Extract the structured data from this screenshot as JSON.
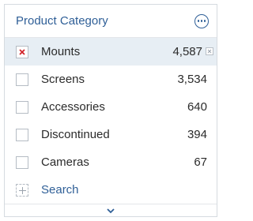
{
  "panel": {
    "title": "Product Category",
    "more_icon": "more-options-icon"
  },
  "items": [
    {
      "label": "Mounts",
      "count": "4,587",
      "selected": true
    },
    {
      "label": "Screens",
      "count": "3,534",
      "selected": false
    },
    {
      "label": "Accessories",
      "count": "640",
      "selected": false
    },
    {
      "label": "Discontinued",
      "count": "394",
      "selected": false
    },
    {
      "label": "Cameras",
      "count": "67",
      "selected": false
    }
  ],
  "search": {
    "label": "Search",
    "icon": "add-icon"
  },
  "footer": {
    "icon": "chevron-down-icon"
  },
  "colors": {
    "accent": "#2f5f97",
    "selected_bg": "#e7eef4",
    "check_red": "#d1242a"
  }
}
